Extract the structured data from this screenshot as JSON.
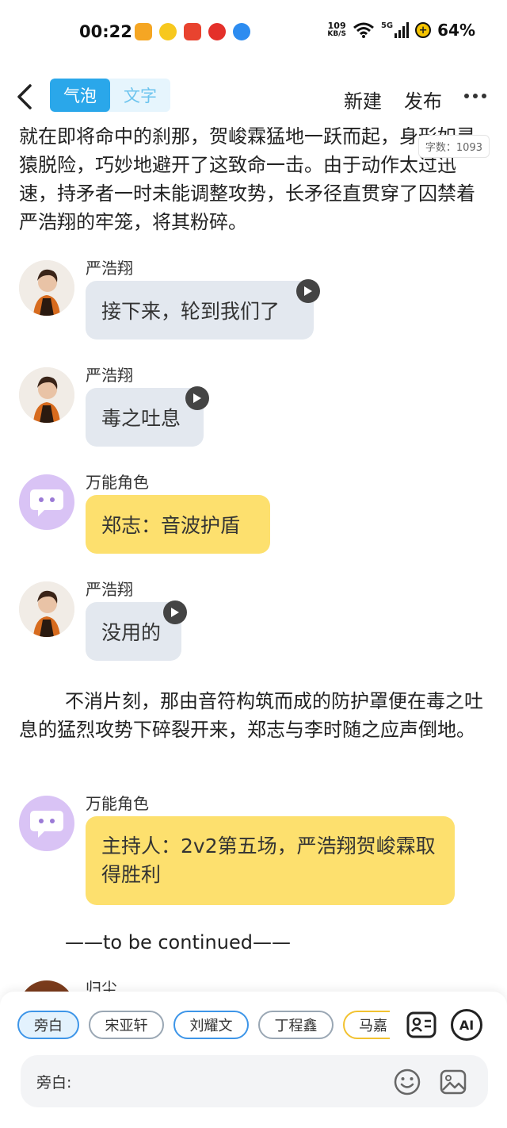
{
  "status": {
    "time": "00:22",
    "net_speed_value": "109",
    "net_speed_unit": "KB/S",
    "network": "5G",
    "battery": "64%",
    "app_icon_colors": [
      "#f5a623",
      "#f7c81e",
      "#e8432f",
      "#e4302a",
      "#2d8cf0"
    ]
  },
  "header": {
    "tabs": [
      {
        "label": "气泡",
        "active": true
      },
      {
        "label": "文字",
        "active": false
      }
    ],
    "new_label": "新建",
    "publish_label": "发布"
  },
  "content": {
    "intro_text": "就在即将命中的刹那，贺峻霖猛地一跃而起，身形如灵猿脱险，巧妙地避开了这致命一击。由于动作太过迅速，持矛者一时未能调整攻势，长矛径直贯穿了囚禁着严浩翔的牢笼，将其粉碎。",
    "word_count": "字数：1093",
    "messages": [
      {
        "name": "严浩翔",
        "text": "接下来，轮到我们了",
        "style": "gray",
        "avatar": "photo",
        "voice": true
      },
      {
        "name": "严浩翔",
        "text": "毒之吐息",
        "style": "gray",
        "avatar": "photo",
        "voice": true
      },
      {
        "name": "万能角色",
        "text": "郑志：音波护盾",
        "style": "yellow",
        "avatar": "bot",
        "voice": false
      },
      {
        "name": "严浩翔",
        "text": "没用的",
        "style": "gray",
        "avatar": "photo",
        "voice": true
      }
    ],
    "narration": "不消片刻，那由音符构筑而成的防护罩便在毒之吐息的猛烈攻势下碎裂开来，郑志与李时随之应声倒地。",
    "final_message": {
      "name": "万能角色",
      "text": "主持人：2v2第五场，严浩翔贺峻霖取得胜利",
      "style": "yellow",
      "avatar": "bot"
    },
    "continued": "——to be continued——",
    "partial_name": "归尘"
  },
  "bottom": {
    "chips": [
      {
        "label": "旁白",
        "selected": true,
        "color": "#3d95e8"
      },
      {
        "label": "宋亚轩",
        "selected": false,
        "color": "#9aa7b4"
      },
      {
        "label": "刘耀文",
        "selected": false,
        "color": "#3d95e8"
      },
      {
        "label": "丁程鑫",
        "selected": false,
        "color": "#9aa7b4"
      },
      {
        "label": "马嘉",
        "selected": false,
        "color": "#f2c230"
      }
    ],
    "ai_label": "AI",
    "input_label": "旁白:"
  }
}
